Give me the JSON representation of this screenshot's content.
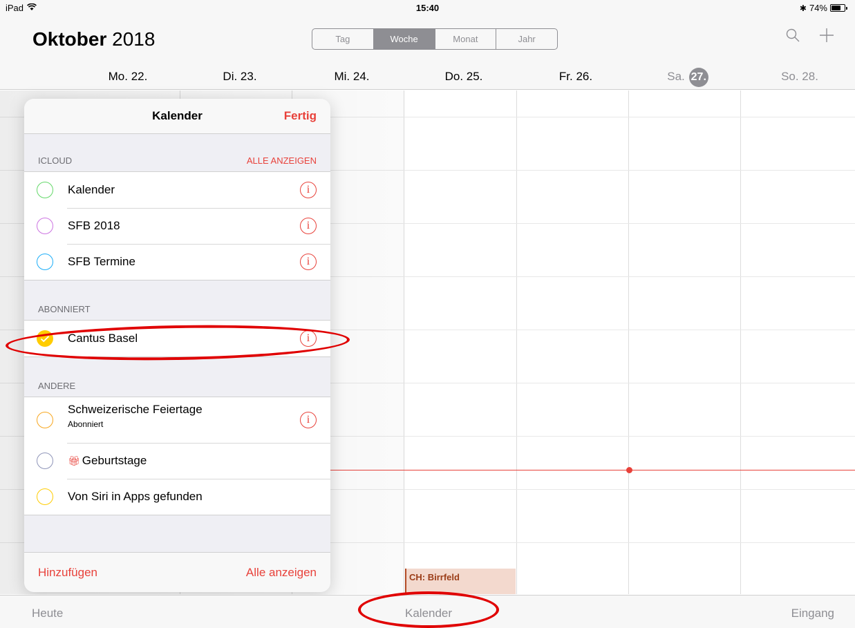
{
  "status": {
    "device": "iPad",
    "time": "15:40",
    "battery": "74%",
    "battery_level": 0.74
  },
  "header": {
    "month_bold": "Oktober",
    "year": "2018",
    "segments": [
      "Tag",
      "Woche",
      "Monat",
      "Jahr"
    ],
    "active_segment": "Woche",
    "days": [
      "Mo. 22.",
      "Di. 23.",
      "Mi. 24.",
      "Do. 25.",
      "Fr. 26.",
      "Sa.",
      "So. 28."
    ],
    "today_number": "27."
  },
  "popover": {
    "title": "Kalender",
    "done_label": "Fertig",
    "icloud": {
      "header": "ICLOUD",
      "action": "ALLE ANZEIGEN",
      "items": [
        {
          "name": "Kalender",
          "color": "#63d868"
        },
        {
          "name": "SFB 2018",
          "color": "#cc73e1"
        },
        {
          "name": "SFB Termine",
          "color": "#1badf8"
        }
      ]
    },
    "subscribed": {
      "header": "ABONNIERT",
      "items": [
        {
          "name": "Cantus Basel",
          "color": "#ffcc00",
          "checked": true
        }
      ]
    },
    "other": {
      "header": "ANDERE",
      "items": [
        {
          "name": "Schweizerische Feiertage",
          "subtitle": "Abonniert",
          "color": "#f7a61e"
        },
        {
          "name": "Geburtstage",
          "color": "#8e94b8"
        },
        {
          "name": "Von Siri in Apps gefunden",
          "color": "#ffcc00"
        }
      ]
    },
    "footer": {
      "add_label": "Hinzufügen",
      "show_all_label": "Alle anzeigen"
    }
  },
  "events": [
    {
      "title": "CH: Birrfeld",
      "day": "Do. 25."
    }
  ],
  "tabbar": {
    "today": "Heute",
    "calendars": "Kalender",
    "inbox": "Eingang"
  },
  "colors": {
    "accent": "#e8413a",
    "annotation": "#e00000"
  }
}
